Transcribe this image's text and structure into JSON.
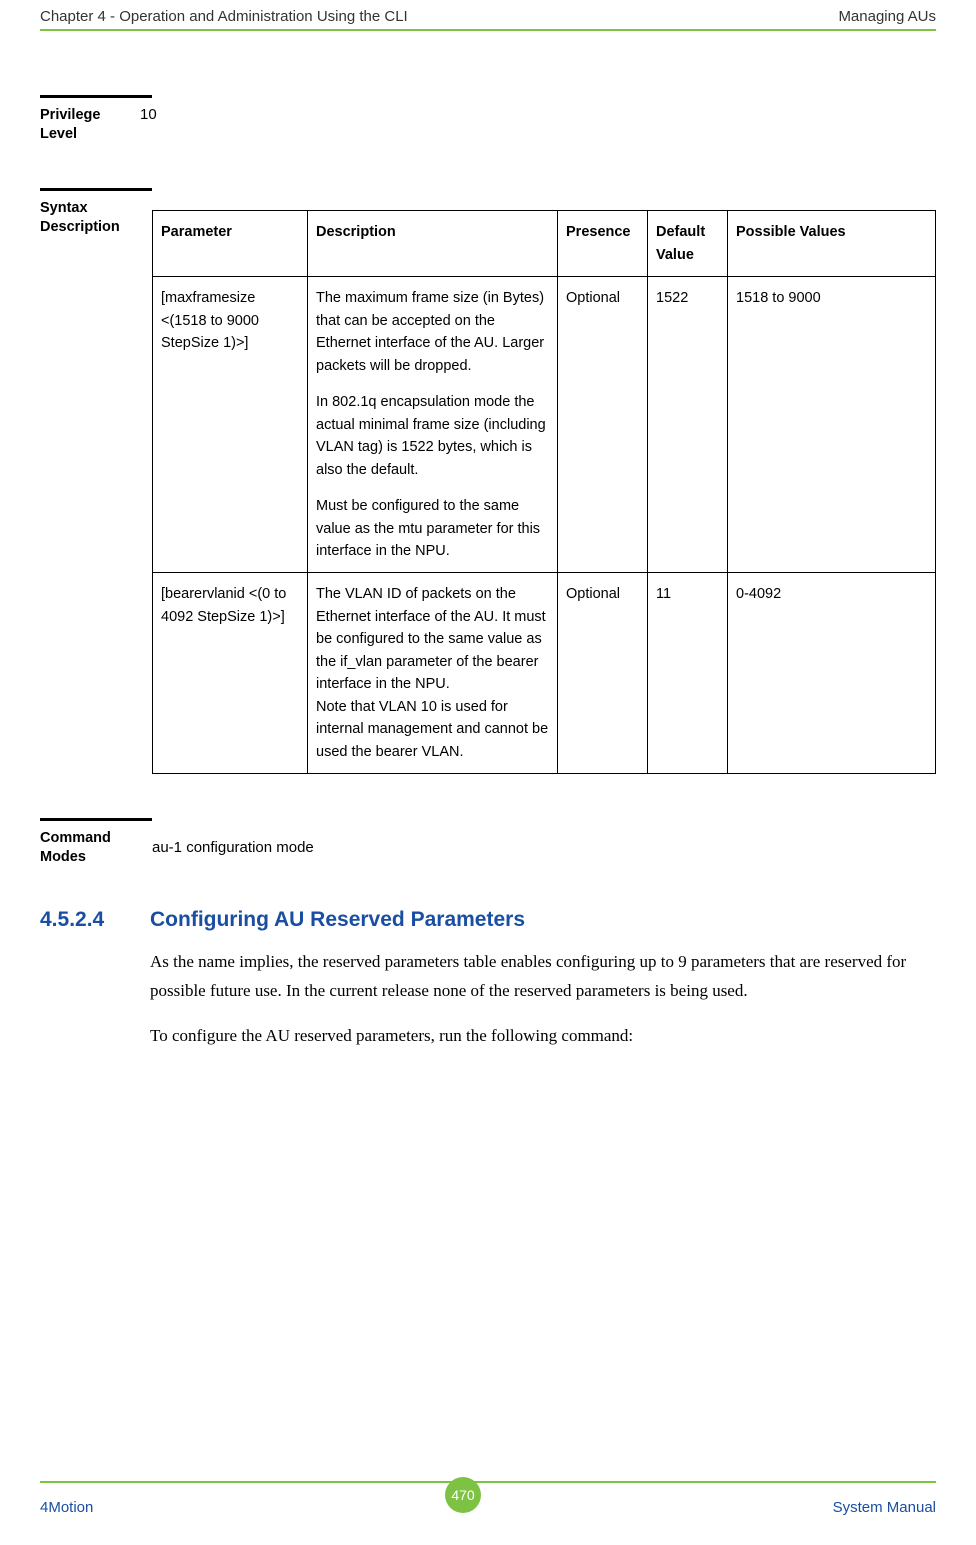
{
  "header": {
    "left": "Chapter 4 - Operation and Administration Using the CLI",
    "right": "Managing AUs"
  },
  "privilege": {
    "label_line1": "Privilege",
    "label_line2": "Level",
    "value": "10"
  },
  "syntax": {
    "label_line1": "Syntax",
    "label_line2": "Description",
    "headers": {
      "parameter": "Parameter",
      "description": "Description",
      "presence": "Presence",
      "default": "Default Value",
      "possible": "Possible Values"
    },
    "rows": [
      {
        "parameter": "[maxframesize <(1518 to 9000 StepSize 1)>]",
        "desc_p1": "The maximum frame size (in Bytes) that can be accepted on the Ethernet interface of the AU. Larger packets will be dropped.",
        "desc_p2": "In 802.1q encapsulation mode the actual minimal frame size (including VLAN tag) is 1522 bytes, which is also the default.",
        "desc_p3": "Must be configured to the same value as the mtu parameter for this interface in the NPU.",
        "presence": "Optional",
        "default": "1522",
        "possible": "1518 to 9000"
      },
      {
        "parameter": "[bearervlanid <(0 to 4092 StepSize 1)>]",
        "desc_p1": "The VLAN ID of packets on the Ethernet interface of the AU. It must be configured to the same value as the if_vlan parameter of the bearer interface in the NPU.\nNote that VLAN 10 is used for internal management and cannot be used the bearer VLAN.",
        "desc_p2": "",
        "desc_p3": "",
        "presence": "Optional",
        "default": "11",
        "possible": "0-4092"
      }
    ]
  },
  "command_modes": {
    "label_line1": "Command",
    "label_line2": "Modes",
    "value": "au-1 configuration mode"
  },
  "subsection": {
    "number": "4.5.2.4",
    "title": "Configuring AU Reserved Parameters",
    "para1": "As the name implies, the reserved parameters table enables configuring up to 9 parameters that are reserved for possible future use. In the current release none of the reserved parameters is being used.",
    "para2": "To configure the AU reserved parameters, run the following command:"
  },
  "footer": {
    "left": "4Motion",
    "page": "470",
    "right": "System Manual"
  }
}
